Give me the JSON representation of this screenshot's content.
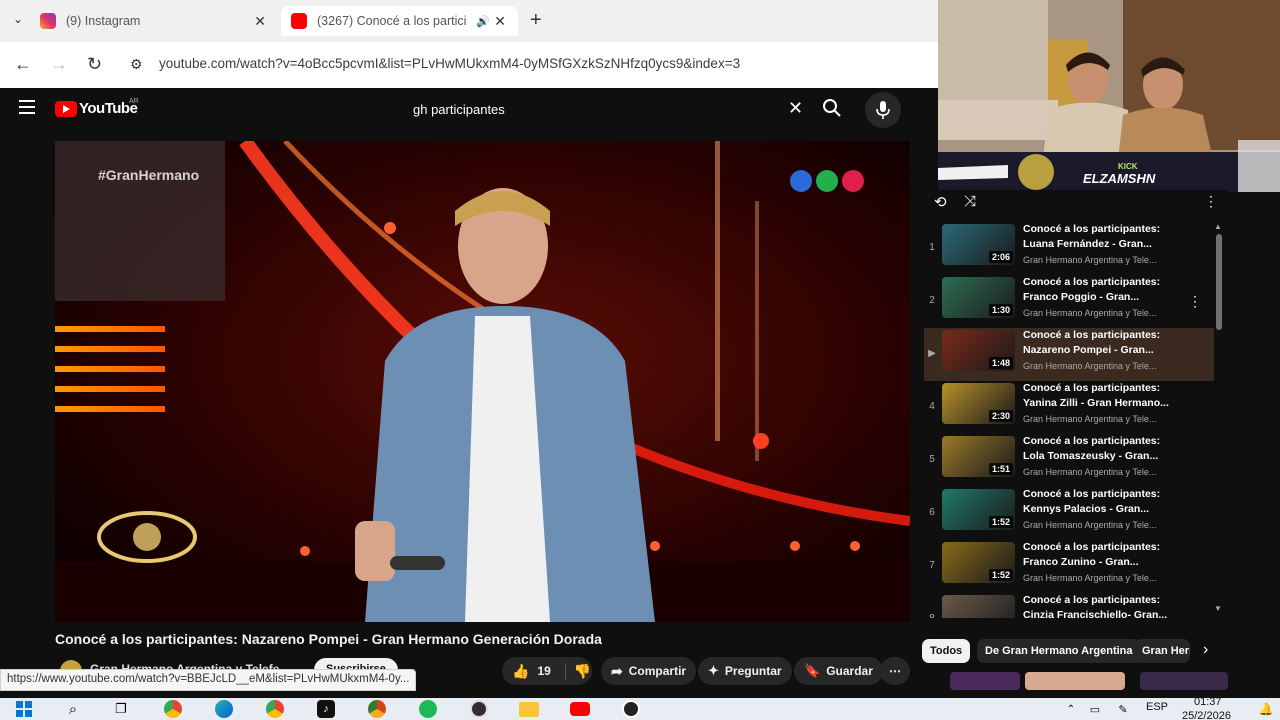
{
  "browser": {
    "tabs": [
      {
        "title": "(9) Instagram",
        "favicon": "instagram-icon"
      },
      {
        "title": "(3267) Conocé a los partici",
        "favicon": "youtube-icon",
        "audio": "speaker-icon"
      }
    ],
    "url": "youtube.com/watch?v=4oBcc5pcvmI&list=PLvHwMUkxmM4-0yMSfGXzkSzNHfzq0ycs9&index=3",
    "status_link": "https://www.youtube.com/watch?v=BBEJcLD__eM&list=PLvHwMUkxmM4-0y..."
  },
  "youtube": {
    "logo_text": "YouTube",
    "region": "AR",
    "search_query": "gh participantes"
  },
  "video": {
    "overlay_hashtag": "#GranHermano",
    "title": "Conocé a los participantes: Nazareno Pompei - Gran Hermano Generación Dorada",
    "channel_partial": "Gran Hermano Argentina y Telefe",
    "subscribe_label": "Suscribirse",
    "likes": "19",
    "share_label": "Compartir",
    "ask_label": "Preguntar",
    "save_label": "Guardar"
  },
  "webcam": {
    "banner_top": "KICK",
    "banner_name": "ELZAMSHN"
  },
  "playlist": {
    "items": [
      {
        "index": "1",
        "title": "Conocé a los participantes: Luana Fernández - Gran...",
        "channel": "Gran Hermano Argentina y Tele...",
        "duration": "2:06",
        "thumb_color": "#2a6a78"
      },
      {
        "index": "2",
        "title": "Conocé a los participantes: Franco Poggio - Gran...",
        "channel": "Gran Hermano Argentina y Tele...",
        "duration": "1:30",
        "thumb_color": "#2f6e54"
      },
      {
        "index": "▶",
        "title": "Conocé a los participantes: Nazareno Pompei - Gran...",
        "channel": "Gran Hermano Argentina y Tele...",
        "duration": "1:48",
        "thumb_color": "#7a2a1a"
      },
      {
        "index": "4",
        "title": "Conocé a los participantes: Yanina Zilli - Gran Hermano...",
        "channel": "Gran Hermano Argentina y Tele...",
        "duration": "2:30",
        "thumb_color": "#b8902a"
      },
      {
        "index": "5",
        "title": "Conocé a los participantes: Lola Tomaszeusky - Gran...",
        "channel": "Gran Hermano Argentina y Tele...",
        "duration": "1:51",
        "thumb_color": "#9a7a2a"
      },
      {
        "index": "6",
        "title": "Conocé a los participantes: Kennys Palacios - Gran...",
        "channel": "Gran Hermano Argentina y Tele...",
        "duration": "1:52",
        "thumb_color": "#1f7a6a"
      },
      {
        "index": "7",
        "title": "Conocé a los participantes: Franco Zunino - Gran...",
        "channel": "Gran Hermano Argentina y Tele...",
        "duration": "1:52",
        "thumb_color": "#8a6a1a"
      },
      {
        "index": "8",
        "title": "Conocé a los participantes: Cinzia Francischiello- Gran...",
        "channel": "",
        "duration": "",
        "thumb_color": "#6a5a4a"
      }
    ]
  },
  "chips": [
    "Todos",
    "De Gran Hermano Argentina",
    "Gran Herm"
  ],
  "taskbar": {
    "lang": "ESP",
    "time": "01:37",
    "date": "25/2/2026"
  },
  "colors": {
    "yt_red": "#ff0000",
    "bg": "#0f0f0f",
    "active_row": "#3a2a20"
  }
}
